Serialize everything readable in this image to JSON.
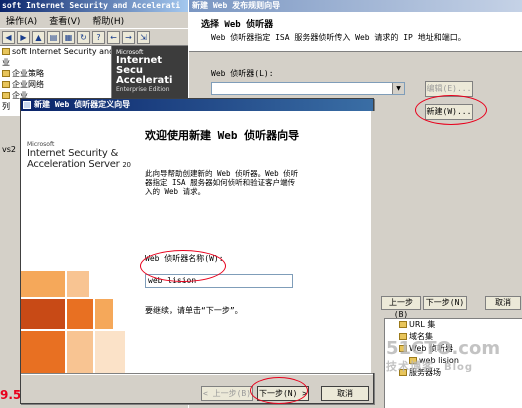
{
  "console": {
    "title": "soft Internet Security and Accelerati",
    "menu": [
      "操作(A)",
      "查看(V)",
      "帮助(H)"
    ],
    "tree": [
      "soft Internet Security and",
      "业",
      "企业策略",
      "企业网络",
      "企业",
      "列",
      "vs2"
    ],
    "banner": {
      "brand": "Microsoft",
      "line1": "Internet Secu",
      "line2": "Accelerati",
      "edition": "Enterprise Edition"
    },
    "date_stamp": "9.5.25"
  },
  "publish_wizard": {
    "title": "新建 Web 发布规则向导",
    "heading": "选择 Web 侦听器",
    "subtitle": "Web 侦听器指定 ISA 服务器侦听传入 Web 请求的 IP 地址和端口。",
    "listener_label": "Web 侦听器(L):",
    "edit_button": "编辑(E)...",
    "new_button": "新建(W)...",
    "back_button": "上一步(B)",
    "next_button": "下一步(N)",
    "cancel_button": "取消",
    "tree": [
      "URL 集",
      "域名集",
      "Web 侦听器",
      "web lision",
      "服务器场"
    ],
    "watermark": {
      "site": "51CTO.com",
      "caption": "技术博客",
      "blog": "Blog"
    }
  },
  "listener_wizard": {
    "title": "新建 Web 侦听器定义向导",
    "brand": {
      "company": "Microsoft",
      "line1": "Internet Security &",
      "line2": "Acceleration Server",
      "year": "2006"
    },
    "heading": "欢迎使用新建 Web 侦听器向导",
    "description": "此向导帮助创建新的 Web 侦听器。Web 侦听器指定 ISA 服务器如何侦听和验证客户端传入的 Web 请求。",
    "name_label": "Web 侦听器名称(W):",
    "name_value": "web lision",
    "continue_text": "要继续，请单击“下一步”。",
    "back_button": "< 上一步(B)",
    "next_button": "下一步(N) >",
    "cancel_button": "取消"
  },
  "colors": {
    "titlebar_active": "#0a246a",
    "highlight_ring": "#e8001c",
    "orange_dark": "#c84a16",
    "orange_mid": "#e87022",
    "orange_light": "#f5a85a"
  }
}
